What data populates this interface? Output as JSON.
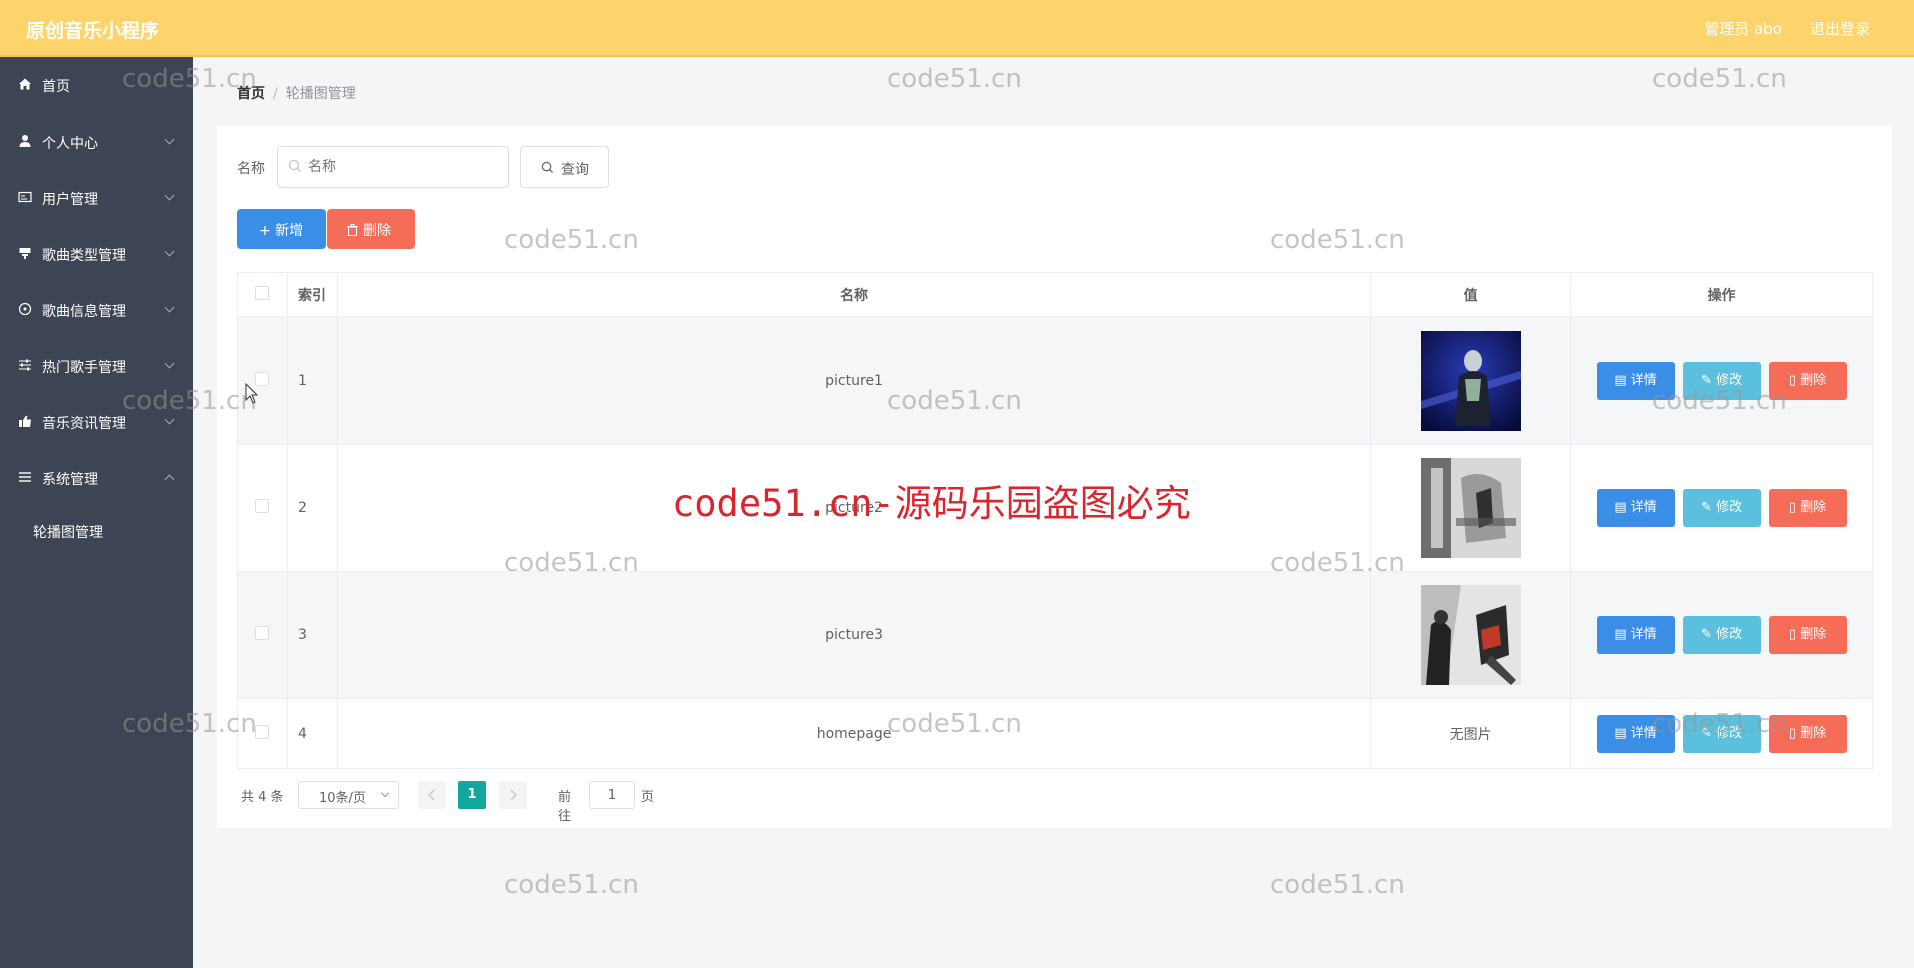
{
  "header": {
    "brand": "原创音乐小程序",
    "user_text": "管理员 abo",
    "logout_label": "退出登录"
  },
  "sidebar": {
    "items": [
      {
        "label": "首页",
        "icon": "home-icon"
      },
      {
        "label": "个人中心",
        "icon": "user-icon"
      },
      {
        "label": "用户管理",
        "icon": "id-card-icon"
      },
      {
        "label": "歌曲类型管理",
        "icon": "shop-icon"
      },
      {
        "label": "歌曲信息管理",
        "icon": "disc-icon"
      },
      {
        "label": "热门歌手管理",
        "icon": "sliders-icon"
      },
      {
        "label": "音乐资讯管理",
        "icon": "thumb-up-icon"
      },
      {
        "label": "系统管理",
        "icon": "list-icon"
      }
    ],
    "sub_items": [
      {
        "label": "轮播图管理"
      }
    ]
  },
  "breadcrumb": {
    "home": "首页",
    "separator": "/",
    "current": "轮播图管理"
  },
  "search": {
    "label": "名称",
    "placeholder": "名称",
    "query_label": "查询"
  },
  "actions": {
    "add_label": "+ 新增",
    "delete_label": "删除"
  },
  "table": {
    "headers": [
      "索引",
      "名称",
      "值",
      "操作"
    ],
    "rows": [
      {
        "index": "1",
        "name": "picture1",
        "value": "",
        "image": "dark-blue-performer-photo"
      },
      {
        "index": "2",
        "name": "picture2",
        "value": "",
        "image": "grayscale-music-poster-photo"
      },
      {
        "index": "3",
        "name": "picture3",
        "value": "",
        "image": "guitar-player-photo"
      },
      {
        "index": "4",
        "name": "homepage",
        "value": "无图片",
        "image": ""
      }
    ],
    "row_actions": {
      "detail": "详情",
      "edit": "修改",
      "delete": "删除"
    }
  },
  "pagination": {
    "total": "共 4 条",
    "page_size": "10条/页",
    "current_page": "1",
    "goto_label": "前往",
    "goto_value": "1",
    "goto_suffix": "页"
  },
  "watermark": {
    "small": "code51.cn",
    "banner": "code51.cn-源码乐园盗图必究"
  },
  "colors": {
    "header_bg": "#fdd46b",
    "sidebar_bg": "#3d4453",
    "primary": "#3a8ee6",
    "danger": "#f56c59",
    "info": "#5bc0de",
    "page_active": "#13a89e",
    "watermark_red": "#d9262e"
  }
}
